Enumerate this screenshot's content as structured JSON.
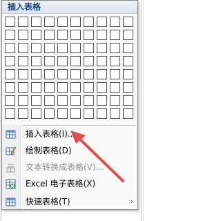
{
  "menu": {
    "header": "插入表格",
    "grid": {
      "rows": 8,
      "cols": 10
    },
    "items": [
      {
        "label": "插入表格(I)...",
        "icon": "insert-table-icon",
        "disabled": false,
        "submenu": false
      },
      {
        "label": "绘制表格(D)",
        "icon": "draw-table-icon",
        "disabled": false,
        "submenu": false
      },
      {
        "label": "文本转换成表格(V)...",
        "icon": "convert-text-icon",
        "disabled": true,
        "submenu": false
      },
      {
        "label": "Excel 电子表格(X)",
        "icon": "excel-icon",
        "disabled": false,
        "submenu": false
      },
      {
        "label": "快速表格(T)",
        "icon": "quick-table-icon",
        "disabled": false,
        "submenu": true
      }
    ]
  },
  "colors": {
    "header_text": "#15428b",
    "annotation_arrow": "#e64b4b"
  }
}
